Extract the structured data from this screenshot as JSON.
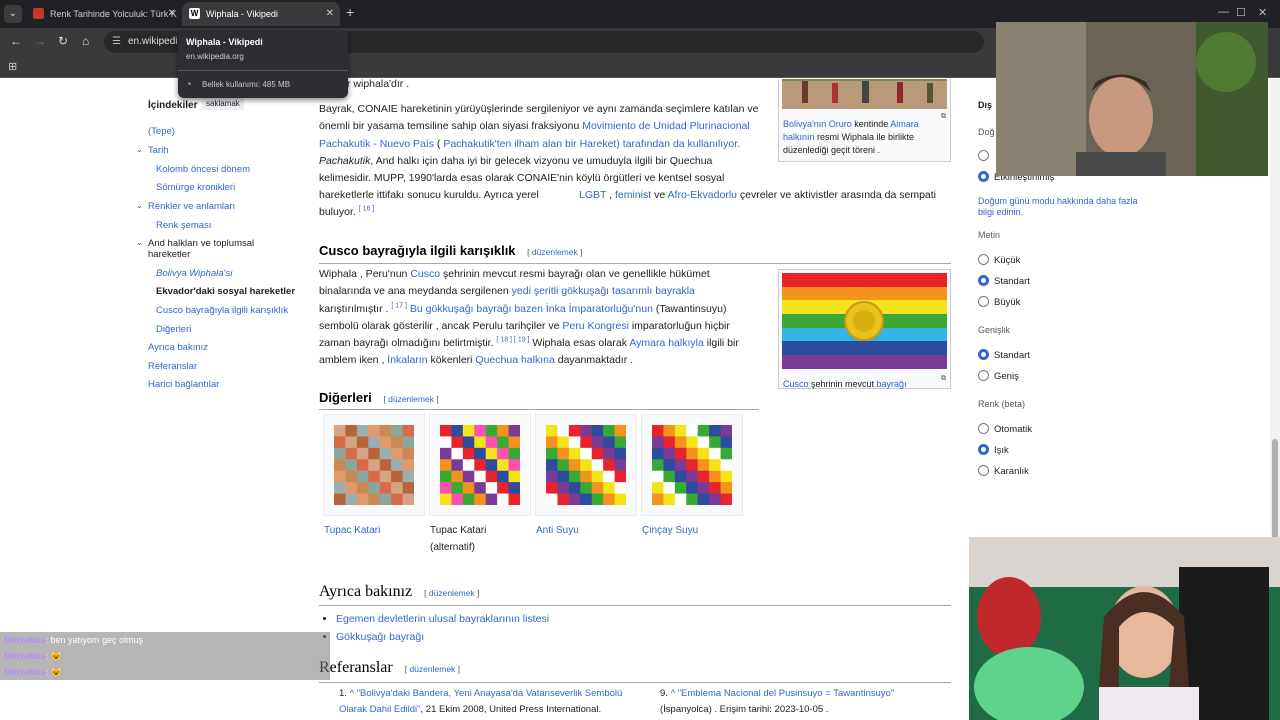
{
  "browser": {
    "tabs": [
      {
        "title": "Renk Tarihinde Yolculuk: Türk K",
        "active": false
      },
      {
        "title": "Wiphala - Vikipedi",
        "active": true
      }
    ],
    "url": "en.wikipedia",
    "tooltip": {
      "title": "Wiphala - Vikipedi",
      "url": "en.wikipedia.org",
      "memory": "Bellek kullanımı: 485 MB"
    }
  },
  "toc": {
    "heading": "İçindekiler",
    "hide": "saklamak",
    "items": [
      {
        "label": "(Tepe)"
      },
      {
        "label": "Tarih"
      },
      {
        "label": "Kolomb öncesi dönem"
      },
      {
        "label": "Sömürge kronikleri"
      },
      {
        "label": "Renkler ve anlamları"
      },
      {
        "label": "Renk şeması"
      },
      {
        "label": "And halkları ve toplumsal hareketler"
      },
      {
        "label": "Bolivya Wiphala'sı"
      },
      {
        "label": "Ekvador'daki sosyal hareketler"
      },
      {
        "label": "Cusco bayrağıyla ilgili karışıklık"
      },
      {
        "label": "Diğerleri"
      },
      {
        "label": "Ayrıca bakınız"
      },
      {
        "label": "Referanslar"
      },
      {
        "label": "Harici bağlantılar"
      }
    ]
  },
  "content": {
    "top_fragment": "...in bir wiphala'dır .",
    "para1": {
      "t1": "Bayrak, CONAIE hareketinin yürüyüşlerinde sergileniyor ve aynı zamanda seçimlere katılan ve önemli bir yasama temsiline sahip olan siyasi fraksiyonu ",
      "l1": "Movimiento de Unidad Plurinacional Pachakutik - Nuevo País",
      "t2": " ( ",
      "l2": "Pachakutik'ten ilham alan bir Hareket) tarafından da kullanılıyor.",
      "t3": " Pachakutik",
      "t4": ", And halkı için daha iyi bir gelecek vizyonu ve umuduyla ilgili bir Quechua kelimesidir. MUPP, 1990'larda esas olarak CONAIE'nin köylü örgütleri ve kentsel sosyal hareketlerle ittifakı sonucu kuruldu. Ayrıca yerel ",
      "l3": "LGBT",
      "t5": " , ",
      "l4": "feminist",
      "t6": " ve ",
      "l5": "Afro-Ekvadorlu",
      "t7": " çevreler ve aktivistler arasında da sempati buluyor.",
      "ref": "[ 16 ]"
    },
    "thumb_top": {
      "l1": "Bolivya'nın Oruro",
      "t1": " kentinde ",
      "l2": "Aimara halkının",
      "t2": " resmi Wiphala ile birlikte düzenlediği geçit töreni ."
    },
    "h_cusco": "Cusco bayrağıyla ilgili karışıklık",
    "edit": "düzenlemek",
    "para2": {
      "t1": "Wiphala , Peru'nun ",
      "l1": "Cusco",
      "t2": " şehrinin mevcut resmi bayrağı olan ve genellikle hükümet binalarında ve ana meydanda sergilenen ",
      "l2": "yedi şeritli gökkuşağı tasarımlı bayrakla",
      "t3": " karıştırılmıştır .",
      "r1": "[ 17 ]",
      "l3": " Bu gökkuşağı bayrağı bazen İnka İmparatorluğu'nun",
      "t4": " (Tawantinsuyu) sembolü olarak gösterilir , ancak Perulu tarihçiler ve ",
      "l4": "Peru Kongresi",
      "t5": " imparatorluğun hiçbir zaman bayrağı olmadığını belirtmiştir.",
      "r2": "[ 18 ] [ 19 ]",
      "t6": " Wiphala esas olarak ",
      "l5": "Aymara halkıyla",
      "t7": " ilgili bir amblem iken , ",
      "l6": "İnkaların",
      "t8": " kökenleri ",
      "l7": "Quechua halkına",
      "t9": " dayanmaktadır ."
    },
    "thumb_cusco": {
      "l1": "Cusco",
      "t1": " şehrinin mevcut ",
      "l2": "bayrağı"
    },
    "h_others": "Diğerleri",
    "gallery": [
      {
        "caption": "Tupac Katari",
        "link": true
      },
      {
        "caption": "Tupac Katari (alternatif)",
        "link": false
      },
      {
        "caption": "Anti Suyu",
        "link": true
      },
      {
        "caption": "Çinçay Suyu",
        "link": true
      }
    ],
    "h_see_also": "Ayrıca bakınız",
    "see_also": [
      "Egemen devletlerin ulusal bayraklarının listesi",
      "Gökkuşağı bayrağı"
    ],
    "h_refs": "Referanslar",
    "refs": [
      {
        "num": "1.",
        "link": "\"Bolivya'daki Bandera, Yeni Anayasa'da Vatanseverlik Sembolü Olarak Dahil Edildi\"",
        "rest": ", 21 Ekim 2008, United Press International."
      },
      {
        "num": "9.",
        "link": "\"Emblema Nacional del Pusinsuyo = Tawantinsuyo\"",
        "rest": "(İspanyolca) . Erişim tarihi: 2023-10-05 ."
      }
    ]
  },
  "sidebar": {
    "title": "Dış",
    "sub": "Doğ",
    "mode_opt": "Etkinleştirilmiş",
    "mode_link": "Doğum günü modu hakkında daha fazla bilgi edinin.",
    "text_h": "Metin",
    "text_opts": [
      "Küçük",
      "Standart",
      "Büyük"
    ],
    "width_h": "Genişlik",
    "width_opts": [
      "Standart",
      "Geniş"
    ],
    "color_h": "Renk (beta)",
    "color_opts": [
      "Otomatik",
      "Işık",
      "Karanlık"
    ]
  },
  "chat": [
    {
      "user": "Merzetius",
      "msg": ": ben yatıyom geç olmuş"
    },
    {
      "user": "Merzetius",
      "msg": ":"
    },
    {
      "user": "Merzetius",
      "msg": ":"
    }
  ]
}
